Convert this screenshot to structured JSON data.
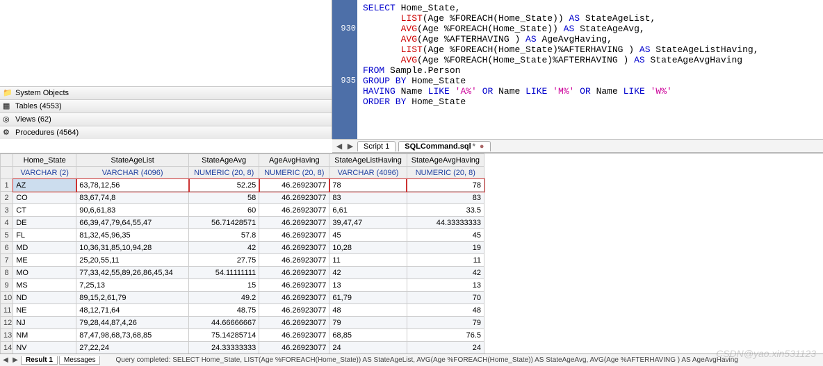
{
  "tree": {
    "system_objects": "System Objects",
    "tables": "Tables (4553)",
    "views": "Views (62)",
    "procedures": "Procedures (4564)"
  },
  "gutter": [
    "",
    "",
    "930",
    "",
    "",
    "",
    "",
    "935",
    "",
    "",
    ""
  ],
  "sql": {
    "l1": {
      "a": "SELECT",
      "b": " Home_State,"
    },
    "l2": {
      "a": "       ",
      "fn": "LIST",
      "b": "(Age %FOREACH(Home_State)) ",
      "as": "AS",
      "c": " StateAgeList,"
    },
    "l3": {
      "a": "       ",
      "fn": "AVG",
      "b": "(Age %FOREACH(Home_State)) ",
      "as": "AS",
      "c": " StateAgeAvg,"
    },
    "l4": {
      "a": "       ",
      "fn": "AVG",
      "b": "(Age %AFTERHAVING ) ",
      "as": "AS",
      "c": " AgeAvgHaving,"
    },
    "l5": {
      "a": "       ",
      "fn": "LIST",
      "b": "(Age %FOREACH(Home_State)%AFTERHAVING ) ",
      "as": "AS",
      "c": " StateAgeListHaving,"
    },
    "l6": {
      "a": "       ",
      "fn": "AVG",
      "b": "(Age %FOREACH(Home_State)%AFTERHAVING ) ",
      "as": "AS",
      "c": " StateAgeAvgHaving"
    },
    "l7": {
      "a": "FROM",
      "b": " Sample.Person"
    },
    "l8": {
      "a": "GROUP BY",
      "b": " Home_State"
    },
    "l9": {
      "a": "HAVING",
      "b": " Name ",
      "c": "LIKE",
      "d": " ",
      "s1": "'A%'",
      "e": " ",
      "or1": "OR",
      "f": " Name ",
      "g": "LIKE",
      "h": " ",
      "s2": "'M%'",
      "i": " ",
      "or2": "OR",
      "j": " Name ",
      "k": "LIKE",
      "l": " ",
      "s3": "'W%'"
    },
    "l10": {
      "a": "ORDER BY",
      "b": " Home_State"
    }
  },
  "editor_tabs": {
    "tab1": "Script 1",
    "tab2": "SQLCommand.sql",
    "dirty": "*"
  },
  "columns": [
    "Home_State",
    "StateAgeList",
    "StateAgeAvg",
    "AgeAvgHaving",
    "StateAgeListHaving",
    "StateAgeAvgHaving"
  ],
  "types": [
    "VARCHAR (2)",
    "VARCHAR (4096)",
    "NUMERIC (20, 8)",
    "NUMERIC (20, 8)",
    "VARCHAR (4096)",
    "NUMERIC (20, 8)"
  ],
  "rows": [
    {
      "n": "1",
      "c": [
        "AZ",
        "63,78,12,56",
        "52.25",
        "46.26923077",
        "78",
        "78"
      ]
    },
    {
      "n": "2",
      "c": [
        "CO",
        "83,67,74,8",
        "58",
        "46.26923077",
        "83",
        "83"
      ]
    },
    {
      "n": "3",
      "c": [
        "CT",
        "90,6,61,83",
        "60",
        "46.26923077",
        "6,61",
        "33.5"
      ]
    },
    {
      "n": "4",
      "c": [
        "DE",
        "66,39,47,79,64,55,47",
        "56.71428571",
        "46.26923077",
        "39,47,47",
        "44.33333333"
      ]
    },
    {
      "n": "5",
      "c": [
        "FL",
        "81,32,45,96,35",
        "57.8",
        "46.26923077",
        "45",
        "45"
      ]
    },
    {
      "n": "6",
      "c": [
        "MD",
        "10,36,31,85,10,94,28",
        "42",
        "46.26923077",
        "10,28",
        "19"
      ]
    },
    {
      "n": "7",
      "c": [
        "ME",
        "25,20,55,11",
        "27.75",
        "46.26923077",
        "11",
        "11"
      ]
    },
    {
      "n": "8",
      "c": [
        "MO",
        "77,33,42,55,89,26,86,45,34",
        "54.11111111",
        "46.26923077",
        "42",
        "42"
      ]
    },
    {
      "n": "9",
      "c": [
        "MS",
        "7,25,13",
        "15",
        "46.26923077",
        "13",
        "13"
      ]
    },
    {
      "n": "10",
      "c": [
        "ND",
        "89,15,2,61,79",
        "49.2",
        "46.26923077",
        "61,79",
        "70"
      ]
    },
    {
      "n": "11",
      "c": [
        "NE",
        "48,12,71,64",
        "48.75",
        "46.26923077",
        "48",
        "48"
      ]
    },
    {
      "n": "12",
      "c": [
        "NJ",
        "79,28,44,87,4,26",
        "44.66666667",
        "46.26923077",
        "79",
        "79"
      ]
    },
    {
      "n": "13",
      "c": [
        "NM",
        "87,47,98,68,73,68,85",
        "75.14285714",
        "46.26923077",
        "68,85",
        "76.5"
      ]
    },
    {
      "n": "14",
      "c": [
        "NV",
        "27,22,24",
        "24.33333333",
        "46.26923077",
        "24",
        "24"
      ]
    }
  ],
  "bottom": {
    "result": "Result 1",
    "messages": "Messages",
    "status": "Query completed: SELECT Home_State,        LIST(Age %FOREACH(Home_State)) AS StateAgeList,        AVG(Age %FOREACH(Home_State)) AS StateAgeAvg,        AVG(Age %AFTERHAVING ) AS AgeAvgHaving"
  },
  "watermark": "CSDN@yao.xin531123"
}
